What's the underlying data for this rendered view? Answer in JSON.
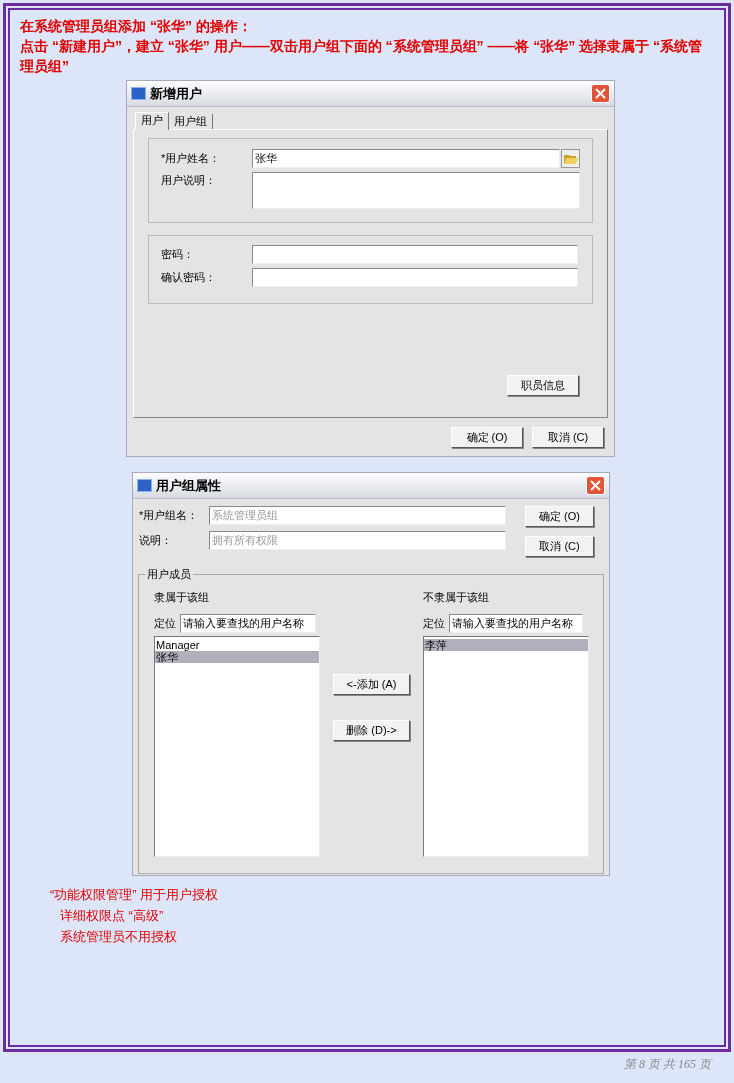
{
  "heading": [
    "在系统管理员组添加 “张华” 的操作：",
    "点击 “新建用户”，建立 “张华” 用户——双击用户组下面的 “系统管理员组” ——将 “张华” 选择隶属于 “系统管理员组”"
  ],
  "new_user_dialog": {
    "title": "新增用户",
    "tabs": [
      {
        "label": "用户",
        "selected": true
      },
      {
        "label": "用户组",
        "selected": false
      }
    ],
    "name_field": {
      "label": "*用户姓名：",
      "value": "张华"
    },
    "description_field": {
      "label": "用户说明："
    },
    "password_field": {
      "label": "密码："
    },
    "confirm_field": {
      "label": "确认密码："
    },
    "staff_button": "职员信息",
    "ok_button": "确定 (O)",
    "cancel_button": "取消 (C)"
  },
  "group_dialog": {
    "title": "用户组属性",
    "name_field": {
      "label": "*用户组名：",
      "value": "系统管理员组",
      "disabled": true
    },
    "description_field": {
      "label": "说明：",
      "value": "拥有所有权限",
      "disabled": true
    },
    "ok_button": "确定 (O)",
    "cancel_button": "取消 (C)",
    "members_group": "用户成员",
    "member_list": {
      "label": "隶属于该组",
      "locate_label": "定位",
      "locate_value": "请输入要查找的用户名称",
      "items": [
        {
          "name": "Manager",
          "selected": false
        },
        {
          "name": "张华",
          "selected": true
        }
      ]
    },
    "add_button": "<-添加 (A)",
    "remove_button": "删除 (D)->",
    "non_member_list": {
      "label": "不隶属于该组",
      "locate_label": "定位",
      "locate_value": "请输入要查找的用户名称",
      "items": [
        {
          "name": "李萍",
          "selected": true
        }
      ]
    }
  },
  "notes": [
    "“功能权限管理” 用于用户授权",
    "详细权限点 “高级”",
    "系统管理员不用授权"
  ],
  "footer": "第 8 页 共 165 页"
}
